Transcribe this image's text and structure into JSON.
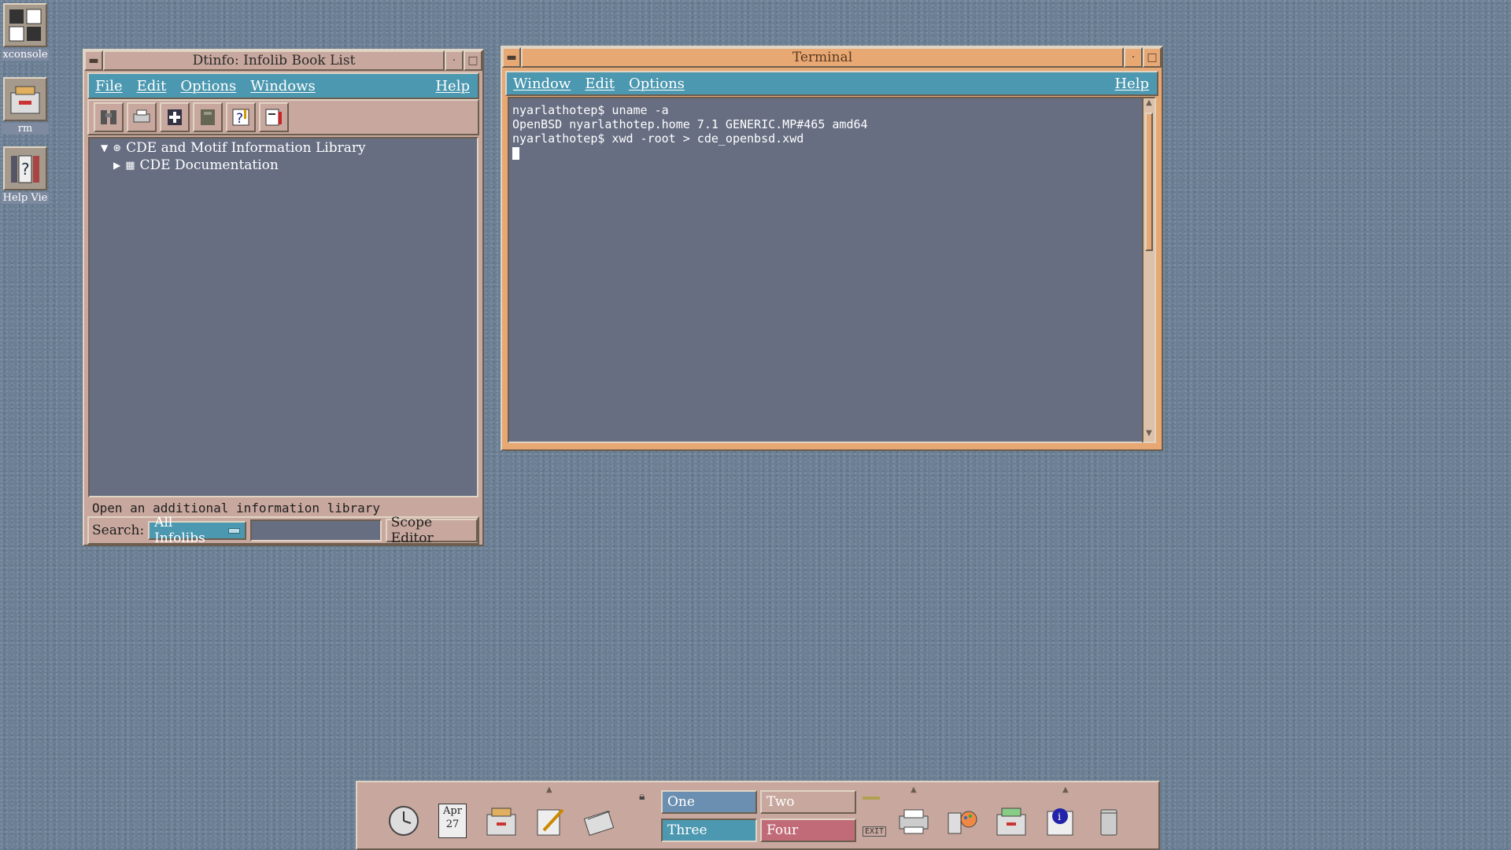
{
  "desktop_icons": [
    {
      "name": "xconsole",
      "label": "xconsole"
    },
    {
      "name": "rm",
      "label": "rm"
    },
    {
      "name": "help-viewer",
      "label": "Help Vie"
    }
  ],
  "dtinfo": {
    "title": "Dtinfo: Infolib Book List",
    "menu": {
      "file": "File",
      "edit": "Edit",
      "options": "Options",
      "windows": "Windows",
      "help": "Help"
    },
    "toolbar_icons": [
      "binoculars-icon",
      "print-icon",
      "add-library-icon",
      "close-library-icon",
      "help-icon",
      "book-icon"
    ],
    "tree": [
      {
        "label": "CDE and Motif Information Library",
        "expanded": true
      },
      {
        "label": "CDE Documentation",
        "expanded": false
      }
    ],
    "status": "Open an additional information library",
    "search": {
      "label": "Search:",
      "scope": "All Infolibs",
      "value": "",
      "scope_editor": "Scope Editor"
    }
  },
  "terminal": {
    "title": "Terminal",
    "menu": {
      "window": "Window",
      "edit": "Edit",
      "options": "Options",
      "help": "Help"
    },
    "lines": [
      "nyarlathotep$ uname -a",
      "OpenBSD nyarlathotep.home 7.1 GENERIC.MP#465 amd64",
      "nyarlathotep$ xwd -root > cde_openbsd.xwd"
    ]
  },
  "front_panel": {
    "calendar": {
      "month": "Apr",
      "day": "27"
    },
    "workspaces": [
      {
        "label": "One",
        "color": "#6b8fb0",
        "active": false
      },
      {
        "label": "Two",
        "color": "#c8a89e",
        "active": false
      },
      {
        "label": "Three",
        "color": "#4c98b0",
        "active": true
      },
      {
        "label": "Four",
        "color": "#c26b78",
        "active": false
      }
    ],
    "exit_label": "EXIT"
  },
  "colors": {
    "desktop": "#6b7f94",
    "panel": "#c8a89e",
    "menubar": "#4c98b0",
    "terminal_frame": "#e8a874",
    "content_bg": "#676e82"
  }
}
